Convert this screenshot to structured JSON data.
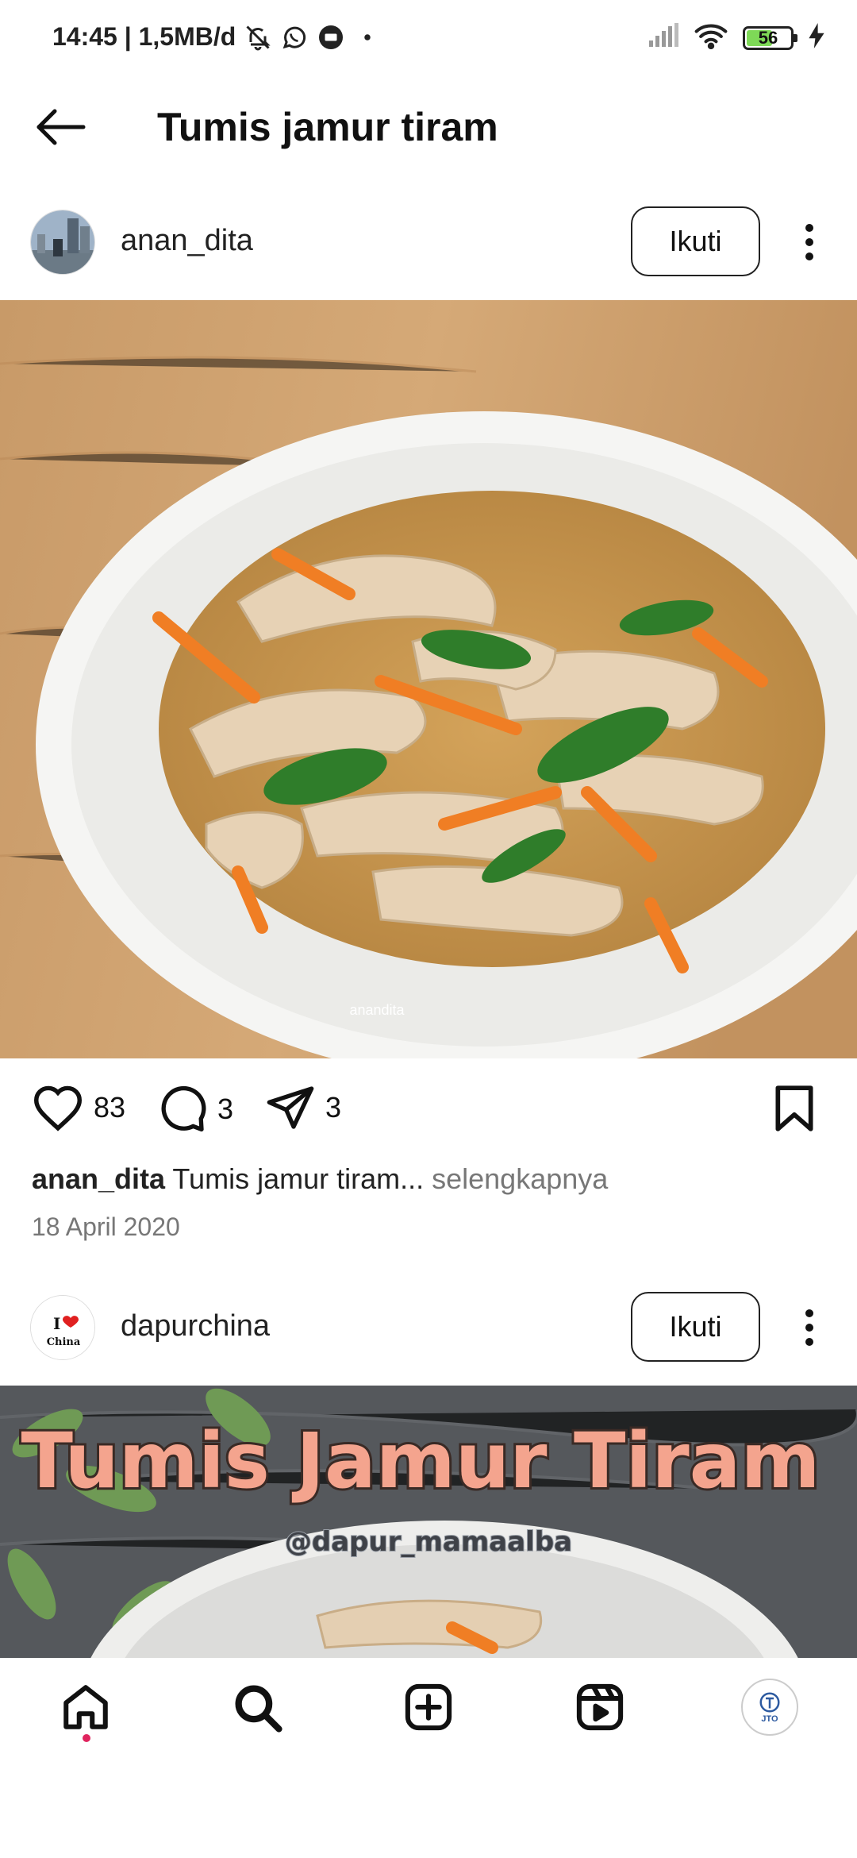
{
  "status_bar": {
    "time_text": "14:45 | 1,5MB/d",
    "battery_level": "56",
    "battery_fraction": 0.56,
    "icons": [
      "bell-off-icon",
      "whatsapp-icon",
      "app-notification-icon",
      "dot-icon",
      "signal-icon",
      "wifi-icon",
      "battery-icon",
      "charging-icon"
    ]
  },
  "header": {
    "title": "Tumis jamur tiram",
    "back_icon": "arrow-left-icon"
  },
  "posts": [
    {
      "username": "anan_dita",
      "follow_label": "Ikuti",
      "image_watermark": "anandita",
      "likes": "83",
      "comments": "3",
      "shares": "3",
      "caption_user": "anan_dita",
      "caption_text": "Tumis jamur tiram...",
      "caption_more": "selengkapnya",
      "date": "18 April 2020"
    },
    {
      "username": "dapurchina",
      "follow_label": "Ikuti",
      "avatar_text_top": "I",
      "avatar_text_bottom": "China",
      "image_title": "Tumis Jamur Tiram",
      "image_handle": "@dapur_mamaalba"
    }
  ],
  "bottom_nav": {
    "items": [
      "home-icon",
      "search-icon",
      "create-icon",
      "reels-icon",
      "profile-icon"
    ],
    "profile_text": "JTO"
  },
  "colors": {
    "accent_dot": "#e0245e",
    "text_secondary": "#777777",
    "battery_fill": "#7ed957",
    "image_title_fill": "#f4a48e"
  }
}
